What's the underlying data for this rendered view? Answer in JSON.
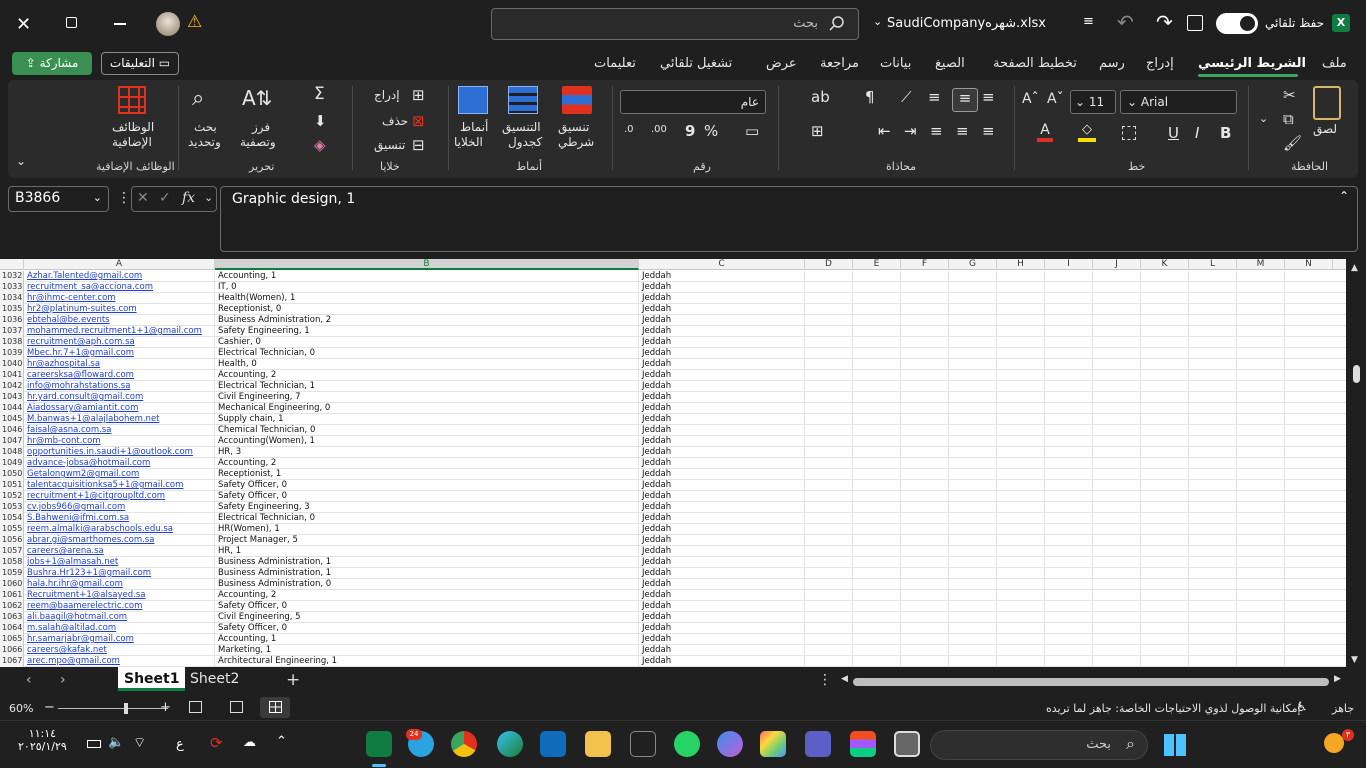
{
  "titlebar": {
    "file_name": "SaudiCompanyشهره.xlsx",
    "search_placeholder": "بحث",
    "autosave_label": "حفظ تلقائي",
    "app_icon_letter": "X"
  },
  "tabs": [
    {
      "label": "ملف"
    },
    {
      "label": "الشريط الرئيسي",
      "active": true
    },
    {
      "label": "إدراج"
    },
    {
      "label": "رسم"
    },
    {
      "label": "تخطيط الصفحة"
    },
    {
      "label": "الصيغ"
    },
    {
      "label": "بيانات"
    },
    {
      "label": "مراجعة"
    },
    {
      "label": "عرض"
    },
    {
      "label": "تشغيل تلقائي"
    },
    {
      "label": "تعليمات"
    }
  ],
  "buttons": {
    "share": "مشاركة",
    "comments": "التعليقات"
  },
  "ribbon": {
    "clipboard": {
      "label": "الحافظة",
      "paste": "لصق"
    },
    "font": {
      "label": "خط",
      "font_name": "Arial",
      "font_size": "11"
    },
    "alignment": {
      "label": "محاذاة"
    },
    "number": {
      "label": "رقم",
      "format": "عام"
    },
    "styles": {
      "label": "أنماط",
      "conditional": "تنسيق",
      "conditional2": "شرطي",
      "as_table": "التنسيق",
      "as_table2": "كجدول",
      "cell_styles": "أنماط",
      "cell_styles2": "الخلايا"
    },
    "cells": {
      "label": "خلايا",
      "insert": "إدراج",
      "delete": "حذف",
      "format": "تنسيق"
    },
    "editing": {
      "label": "تحرير",
      "sort": "فرز",
      "sort2": "وتصفية",
      "find": "بحث",
      "find2": "وتحديد"
    },
    "addins": {
      "label": "الوظائف الإضافية",
      "btn": "الوظائف",
      "btn2": "الإضافية"
    }
  },
  "formula_bar": {
    "name_box": "B3866",
    "formula": "Graphic design, 1"
  },
  "columns": [
    "A",
    "B",
    "C",
    "D",
    "E",
    "F",
    "G",
    "H",
    "I",
    "J",
    "K",
    "L",
    "M",
    "N"
  ],
  "rows": [
    {
      "n": "1032",
      "a": "Azhar.Talented@gmail.com",
      "b": "Accounting, 1",
      "c": "Jeddah"
    },
    {
      "n": "1033",
      "a": "recruitment_sa@acciona.com",
      "b": "IT, 0",
      "c": "Jeddah"
    },
    {
      "n": "1034",
      "a": "hr@ihmc-center.com",
      "b": "Health(Women), 1",
      "c": "Jeddah"
    },
    {
      "n": "1035",
      "a": "hr2@platinum-suites.com",
      "b": "Receptionist, 0",
      "c": "Jeddah"
    },
    {
      "n": "1036",
      "a": "ebtehal@be.events",
      "b": "Business Administration, 2",
      "c": "Jeddah"
    },
    {
      "n": "1037",
      "a": "mohammed.recruitment1+1@gmail.com",
      "b": "Safety Engineering, 1",
      "c": "Jeddah"
    },
    {
      "n": "1038",
      "a": "recruitment@aph.com.sa",
      "b": "Cashier, 0",
      "c": "Jeddah"
    },
    {
      "n": "1039",
      "a": "Mbec.hr.7+1@gmail.com",
      "b": "Electrical Technician, 0",
      "c": "Jeddah"
    },
    {
      "n": "1040",
      "a": "hr@azhospital.sa",
      "b": "Health, 0",
      "c": "Jeddah"
    },
    {
      "n": "1041",
      "a": "careersksa@floward.com",
      "b": "Accounting, 2",
      "c": "Jeddah"
    },
    {
      "n": "1042",
      "a": "info@mohrahstations.sa",
      "b": "Electrical Technician, 1",
      "c": "Jeddah"
    },
    {
      "n": "1043",
      "a": "hr.yard.consult@gmail.com",
      "b": "Civil Engineering, 7",
      "c": "Jeddah"
    },
    {
      "n": "1044",
      "a": "Aiadossary@amiantit.com",
      "b": "Mechanical Engineering, 0",
      "c": "Jeddah"
    },
    {
      "n": "1045",
      "a": "M.banwas+1@alajlabohem.net",
      "b": "Supply chain, 1",
      "c": "Jeddah"
    },
    {
      "n": "1046",
      "a": "faisal@asna.com.sa",
      "b": "Chemical Technician, 0",
      "c": "Jeddah"
    },
    {
      "n": "1047",
      "a": "hr@mb-cont.com",
      "b": "Accounting(Women), 1",
      "c": "Jeddah"
    },
    {
      "n": "1048",
      "a": "opportunities.in.saudi+1@outlook.com",
      "b": "HR, 3",
      "c": "Jeddah"
    },
    {
      "n": "1049",
      "a": "advance-jobsa@hotmail.com",
      "b": "Accounting, 2",
      "c": "Jeddah"
    },
    {
      "n": "1050",
      "a": "Getalongwm2@gmail.com",
      "b": "Receptionist, 1",
      "c": "Jeddah"
    },
    {
      "n": "1051",
      "a": "talentacquisitionksa5+1@gmail.com",
      "b": "Safety Officer, 0",
      "c": "Jeddah"
    },
    {
      "n": "1052",
      "a": "recruitment+1@citgroupltd.com",
      "b": "Safety Officer, 0",
      "c": "Jeddah"
    },
    {
      "n": "1053",
      "a": "cv.jobs966@gmail.com",
      "b": "Safety Engineering, 3",
      "c": "Jeddah"
    },
    {
      "n": "1054",
      "a": "S.Bahweni@ifmi.com.sa",
      "b": "Electrical Technician, 0",
      "c": "Jeddah"
    },
    {
      "n": "1055",
      "a": "reem.almalki@arabschools.edu.sa",
      "b": "HR(Women), 1",
      "c": "Jeddah"
    },
    {
      "n": "1056",
      "a": "abrar.gi@smarthomes.com.sa",
      "b": "Project Manager, 5",
      "c": "Jeddah"
    },
    {
      "n": "1057",
      "a": "careers@arena.sa",
      "b": "HR, 1",
      "c": "Jeddah"
    },
    {
      "n": "1058",
      "a": "jobs+1@almasah.net",
      "b": "Business Administration, 1",
      "c": "Jeddah"
    },
    {
      "n": "1059",
      "a": "Bushra.Hr123+1@gmail.com",
      "b": "Business Administration, 1",
      "c": "Jeddah"
    },
    {
      "n": "1060",
      "a": "hala.hr.ihr@gmail.com",
      "b": "Business Administration, 0",
      "c": "Jeddah"
    },
    {
      "n": "1061",
      "a": "Recruitment+1@alsayed.sa",
      "b": "Accounting, 2",
      "c": "Jeddah"
    },
    {
      "n": "1062",
      "a": "reem@baamerelectric.com",
      "b": "Safety Officer, 0",
      "c": "Jeddah"
    },
    {
      "n": "1063",
      "a": "ali.baagil@hotmail.com",
      "b": "Civil Engineering, 5",
      "c": "Jeddah"
    },
    {
      "n": "1064",
      "a": "m.salah@altilad.com",
      "b": "Safety Officer, 0",
      "c": "Jeddah"
    },
    {
      "n": "1065",
      "a": "hr.samarjabr@gmail.com",
      "b": "Accounting, 1",
      "c": "Jeddah"
    },
    {
      "n": "1066",
      "a": "careers@kafak.net",
      "b": "Marketing, 1",
      "c": "Jeddah"
    },
    {
      "n": "1067",
      "a": "arec.mpo@gmail.com",
      "b": "Architectural Engineering, 1",
      "c": "Jeddah"
    }
  ],
  "sheets": [
    {
      "label": "Sheet1",
      "active": true
    },
    {
      "label": "Sheet2"
    }
  ],
  "status": {
    "ready": "جاهز",
    "accessibility": "إمكانية الوصول لذوي الاحتياجات الخاصة: جاهز لما تريده",
    "zoom": "60%"
  },
  "taskbar": {
    "search_placeholder": "بحث",
    "time": "١١:١٤",
    "date": "٢٠٢٥/١/٢٩",
    "lang": "ع",
    "telegram_badge": "24",
    "notification_count": "٣"
  },
  "colors": {
    "accent_green": "#107c41",
    "share_green": "#3a8f52",
    "link_blue": "#1f3fd0"
  }
}
